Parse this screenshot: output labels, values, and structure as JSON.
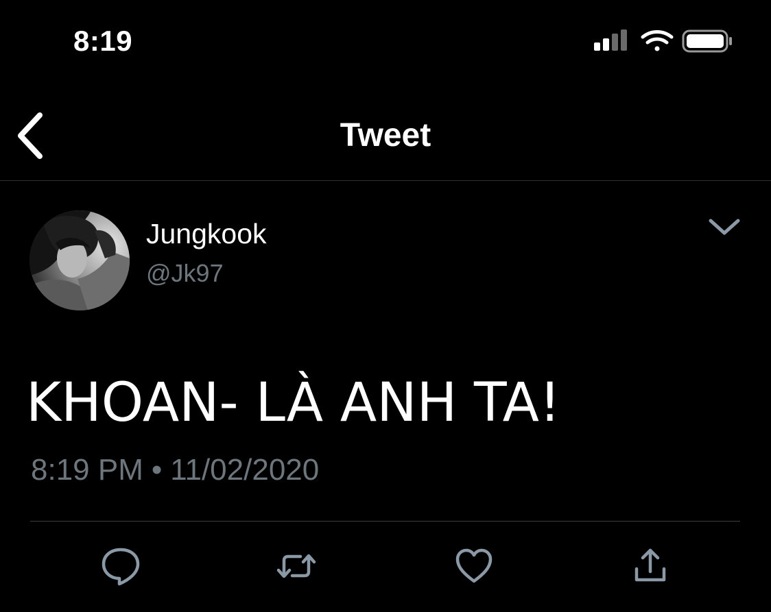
{
  "status_bar": {
    "time": "8:19",
    "signal_icon": "cellular-signal-icon",
    "wifi_icon": "wifi-icon",
    "battery_icon": "battery-icon"
  },
  "nav": {
    "back_icon": "chevron-left-icon",
    "title": "Tweet"
  },
  "tweet": {
    "author": {
      "display_name": "Jungkook",
      "handle": "@Jk97"
    },
    "menu_icon": "chevron-down-icon",
    "text": "KHOAN- LÀ ANH TA!",
    "time": "8:19 PM",
    "separator": "•",
    "date": "11/02/2020"
  },
  "actions": [
    {
      "icon": "reply-icon"
    },
    {
      "icon": "retweet-icon"
    },
    {
      "icon": "like-icon"
    },
    {
      "icon": "share-icon"
    }
  ],
  "colors": {
    "background": "#000000",
    "text_primary": "#ffffff",
    "text_secondary": "#6e767d",
    "icon": "#8b98a5",
    "divider": "#2f3336"
  }
}
